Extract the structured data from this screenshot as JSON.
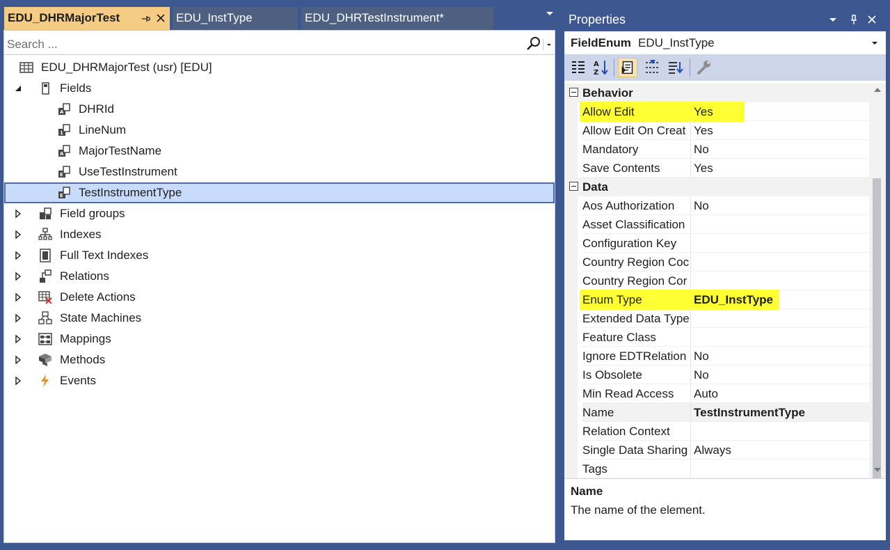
{
  "document_tabs": [
    {
      "label": "EDU_DHRMajorTest",
      "active": true
    },
    {
      "label": "EDU_InstType",
      "active": false
    },
    {
      "label": "EDU_DHRTestInstrument*",
      "active": false
    }
  ],
  "search": {
    "placeholder": "Search ..."
  },
  "tree": {
    "root": {
      "label": "EDU_DHRMajorTest (usr) [EDU]",
      "icon": "table-icon"
    },
    "fields_node": {
      "label": "Fields",
      "icon": "fields-icon",
      "expanded": true
    },
    "fields": [
      {
        "label": "DHRId",
        "icon": "string-field-icon",
        "selected": false
      },
      {
        "label": "LineNum",
        "icon": "real-field-icon",
        "selected": false
      },
      {
        "label": "MajorTestName",
        "icon": "string-field-icon",
        "selected": false
      },
      {
        "label": "UseTestInstrument",
        "icon": "enum-field-icon",
        "selected": false
      },
      {
        "label": "TestInstrumentType",
        "icon": "enum-field-icon",
        "selected": true
      }
    ],
    "nodes": [
      {
        "label": "Field groups",
        "icon": "field-groups-icon"
      },
      {
        "label": "Indexes",
        "icon": "indexes-icon"
      },
      {
        "label": "Full Text Indexes",
        "icon": "full-text-indexes-icon"
      },
      {
        "label": "Relations",
        "icon": "relations-icon"
      },
      {
        "label": "Delete Actions",
        "icon": "delete-actions-icon"
      },
      {
        "label": "State Machines",
        "icon": "state-machines-icon"
      },
      {
        "label": "Mappings",
        "icon": "mappings-icon"
      },
      {
        "label": "Methods",
        "icon": "methods-icon"
      },
      {
        "label": "Events",
        "icon": "events-icon"
      }
    ]
  },
  "properties": {
    "title": "Properties",
    "object_kind": "FieldEnum",
    "object_name": "EDU_InstType",
    "toolbar": [
      "categorized-icon",
      "alphabetical-icon",
      "properties-icon",
      "events-list-icon",
      "property-pages-icon",
      "wrench-icon"
    ],
    "categories": [
      {
        "name": "Behavior",
        "rows": [
          {
            "name": "Allow Edit",
            "value": "Yes",
            "highlight": true
          },
          {
            "name": "Allow Edit On Creat",
            "value": "Yes"
          },
          {
            "name": "Mandatory",
            "value": "No"
          },
          {
            "name": "Save Contents",
            "value": "Yes"
          }
        ]
      },
      {
        "name": "Data",
        "rows": [
          {
            "name": "Aos Authorization",
            "value": "No"
          },
          {
            "name": "Asset Classification",
            "value": ""
          },
          {
            "name": "Configuration Key",
            "value": ""
          },
          {
            "name": "Country Region Coc",
            "value": ""
          },
          {
            "name": "Country Region Cor",
            "value": ""
          },
          {
            "name": "Enum Type",
            "value": "EDU_InstType",
            "bold": true,
            "highlight": true
          },
          {
            "name": "Extended Data Type",
            "value": ""
          },
          {
            "name": "Feature Class",
            "value": ""
          },
          {
            "name": "Ignore EDTRelation",
            "value": "No"
          },
          {
            "name": "Is Obsolete",
            "value": "No"
          },
          {
            "name": "Min Read Access",
            "value": "Auto"
          },
          {
            "name": "Name",
            "value": "TestInstrumentType",
            "bold": true,
            "selected": true
          },
          {
            "name": "Relation Context",
            "value": ""
          },
          {
            "name": "Single Data Sharing",
            "value": "Always"
          },
          {
            "name": "Tags",
            "value": ""
          }
        ]
      }
    ],
    "description": {
      "title": "Name",
      "text": "The name of the element."
    }
  },
  "colors": {
    "frame": "#3d5790",
    "active_tab": "#f5cc84",
    "selection": "#c9dbfb",
    "highlight": "#ffff33"
  }
}
